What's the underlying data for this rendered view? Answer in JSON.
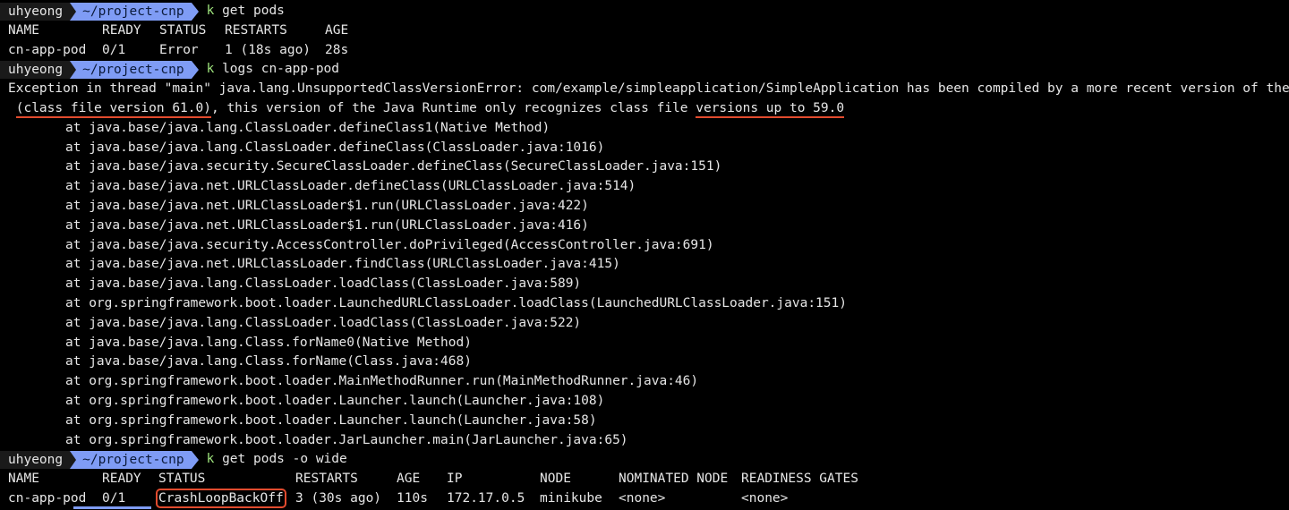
{
  "prompt": {
    "user": "uhyeong",
    "dir": "~/project-cnp",
    "k": "k"
  },
  "cmd1": " get pods",
  "cmd2": " logs cn-app-pod",
  "cmd3": " get pods -o wide",
  "pods_table1": {
    "headers": [
      "NAME",
      "READY",
      "STATUS",
      "RESTARTS",
      "AGE"
    ],
    "row": [
      "cn-app-pod",
      "0/1",
      "Error",
      "1 (18s ago)",
      "28s"
    ]
  },
  "exception": {
    "line1": "Exception in thread \"main\" java.lang.UnsupportedClassVersionError: com/example/simpleapplication/SimpleApplication has been compiled by a more recent version of the Java Runtime",
    "line2_pre": " ",
    "line2_hl1": "(class file version 61.0)",
    "line2_mid": ", this version of the Java Runtime only recognizes class file ",
    "line2_hl2": "versions up to 59.0"
  },
  "stack": [
    "at java.base/java.lang.ClassLoader.defineClass1(Native Method)",
    "at java.base/java.lang.ClassLoader.defineClass(ClassLoader.java:1016)",
    "at java.base/java.security.SecureClassLoader.defineClass(SecureClassLoader.java:151)",
    "at java.base/java.net.URLClassLoader.defineClass(URLClassLoader.java:514)",
    "at java.base/java.net.URLClassLoader$1.run(URLClassLoader.java:422)",
    "at java.base/java.net.URLClassLoader$1.run(URLClassLoader.java:416)",
    "at java.base/java.security.AccessController.doPrivileged(AccessController.java:691)",
    "at java.base/java.net.URLClassLoader.findClass(URLClassLoader.java:415)",
    "at java.base/java.lang.ClassLoader.loadClass(ClassLoader.java:589)",
    "at org.springframework.boot.loader.LaunchedURLClassLoader.loadClass(LaunchedURLClassLoader.java:151)",
    "at java.base/java.lang.ClassLoader.loadClass(ClassLoader.java:522)",
    "at java.base/java.lang.Class.forName0(Native Method)",
    "at java.base/java.lang.Class.forName(Class.java:468)",
    "at org.springframework.boot.loader.MainMethodRunner.run(MainMethodRunner.java:46)",
    "at org.springframework.boot.loader.Launcher.launch(Launcher.java:108)",
    "at org.springframework.boot.loader.Launcher.launch(Launcher.java:58)",
    "at org.springframework.boot.loader.JarLauncher.main(JarLauncher.java:65)"
  ],
  "pods_table2": {
    "headers": [
      "NAME",
      "READY",
      "STATUS",
      "RESTARTS",
      "AGE",
      "IP",
      "NODE",
      "NOMINATED NODE",
      "READINESS GATES"
    ],
    "row": [
      "cn-app-pod",
      "0/1",
      "CrashLoopBackOff",
      "3 (30s ago)",
      "110s",
      "172.17.0.5",
      "minikube",
      "<none>",
      "<none>"
    ]
  },
  "colors": {
    "background": "#000000",
    "foreground": "#e6e6e6",
    "prompt_user_bg": "#1a1a1a",
    "prompt_dir_bg": "#7f9cf5",
    "command_k": "#9ee37d",
    "highlight_red": "#e24b2e"
  }
}
